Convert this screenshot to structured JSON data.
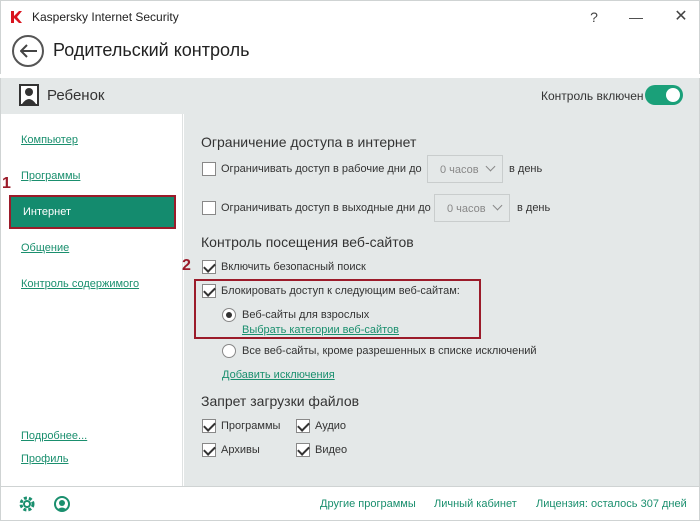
{
  "window": {
    "title": "Kaspersky Internet Security",
    "help": "?",
    "minimize": "—",
    "close": "✕"
  },
  "header": {
    "title": "Родительский контроль"
  },
  "profile": {
    "name": "Ребенок",
    "control_label": "Контроль включен",
    "control_enabled": true,
    "accent": "#1aa079"
  },
  "sidebar": {
    "items": [
      {
        "label": "Компьютер"
      },
      {
        "label": "Программы"
      },
      {
        "label": "Интернет"
      },
      {
        "label": "Общение"
      },
      {
        "label": "Контроль содержимого"
      }
    ],
    "more": "Подробнее...",
    "profile_link": "Профиль",
    "marker_1": "1"
  },
  "main": {
    "access": {
      "title": "Ограничение доступа в интернет",
      "workdays": {
        "label": "Ограничивать доступ в рабочие дни до",
        "checked": false,
        "value": "0 часов",
        "suffix": "в день"
      },
      "weekends": {
        "label": "Ограничивать доступ в выходные дни до",
        "checked": false,
        "value": "0 часов",
        "suffix": "в день"
      }
    },
    "sites": {
      "title": "Контроль посещения веб-сайтов",
      "marker_2": "2",
      "safe_search": {
        "label": "Включить безопасный поиск",
        "checked": true
      },
      "block": {
        "label": "Блокировать доступ к следующим веб-сайтам:",
        "checked": true
      },
      "adult": {
        "label": "Веб-сайты для взрослых",
        "selected": true
      },
      "choose_categories": "Выбрать категории веб-сайтов",
      "all_except": {
        "label": "Все веб-сайты, кроме разрешенных в списке исключений",
        "selected": false
      },
      "add_exceptions": "Добавить исключения"
    },
    "downloads": {
      "title": "Запрет загрузки файлов",
      "programs": {
        "label": "Программы",
        "checked": true
      },
      "audio": {
        "label": "Аудио",
        "checked": true
      },
      "archives": {
        "label": "Архивы",
        "checked": true
      },
      "video": {
        "label": "Видео",
        "checked": true
      }
    }
  },
  "footer": {
    "other_programs": "Другие программы",
    "account": "Личный кабинет",
    "license": "Лицензия: осталось 307 дней"
  }
}
